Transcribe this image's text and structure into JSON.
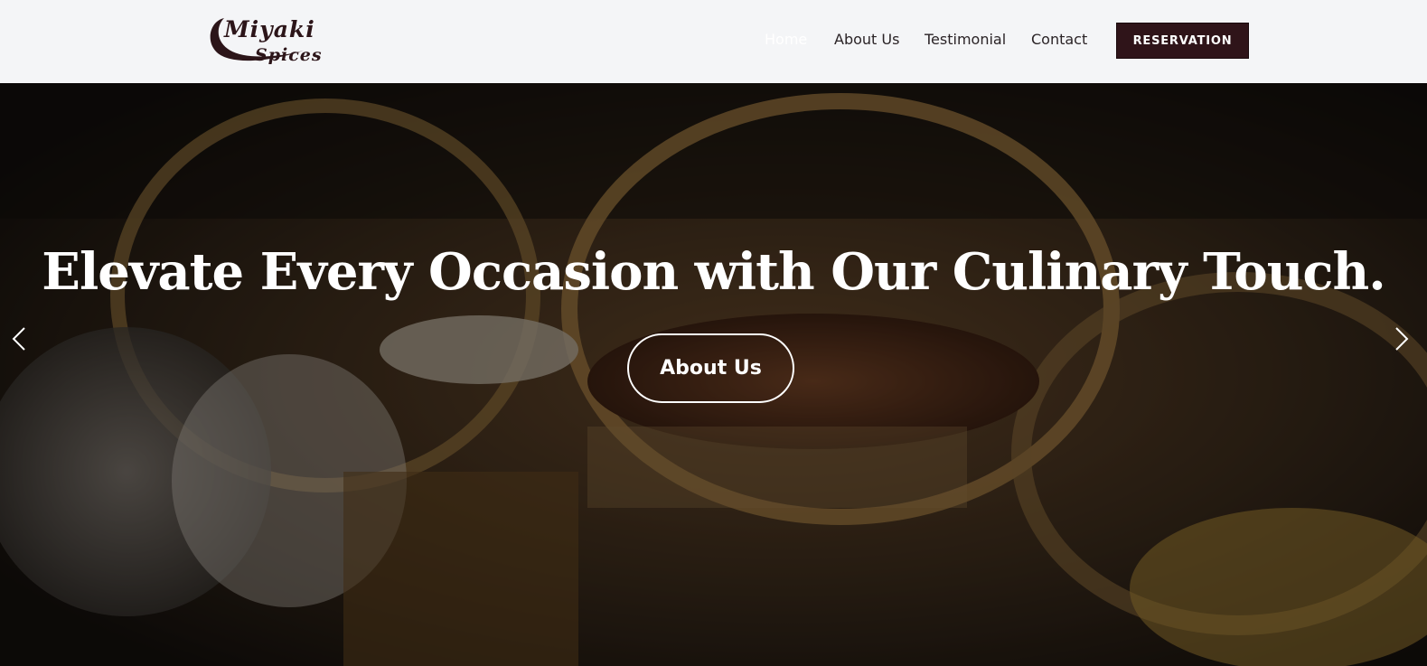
{
  "brand": {
    "line1": "Miyaki",
    "line2": "Spices",
    "icon": "crescent-swoosh-icon"
  },
  "nav": {
    "items": [
      {
        "label": "Home",
        "active": true
      },
      {
        "label": "About Us",
        "active": false
      },
      {
        "label": "Testimonial",
        "active": false
      },
      {
        "label": "Contact",
        "active": false
      }
    ],
    "cta_label": "RESERVATION"
  },
  "hero": {
    "title": "Elevate Every Occasion with Our Culinary Touch.",
    "button_label": "About Us",
    "prev_icon": "chevron-left-icon",
    "next_icon": "chevron-right-icon"
  },
  "colors": {
    "nav_bg": "#f4f5f7",
    "accent": "#2f1419",
    "nav_text": "#2a2326",
    "hero_text": "#ffffff"
  }
}
